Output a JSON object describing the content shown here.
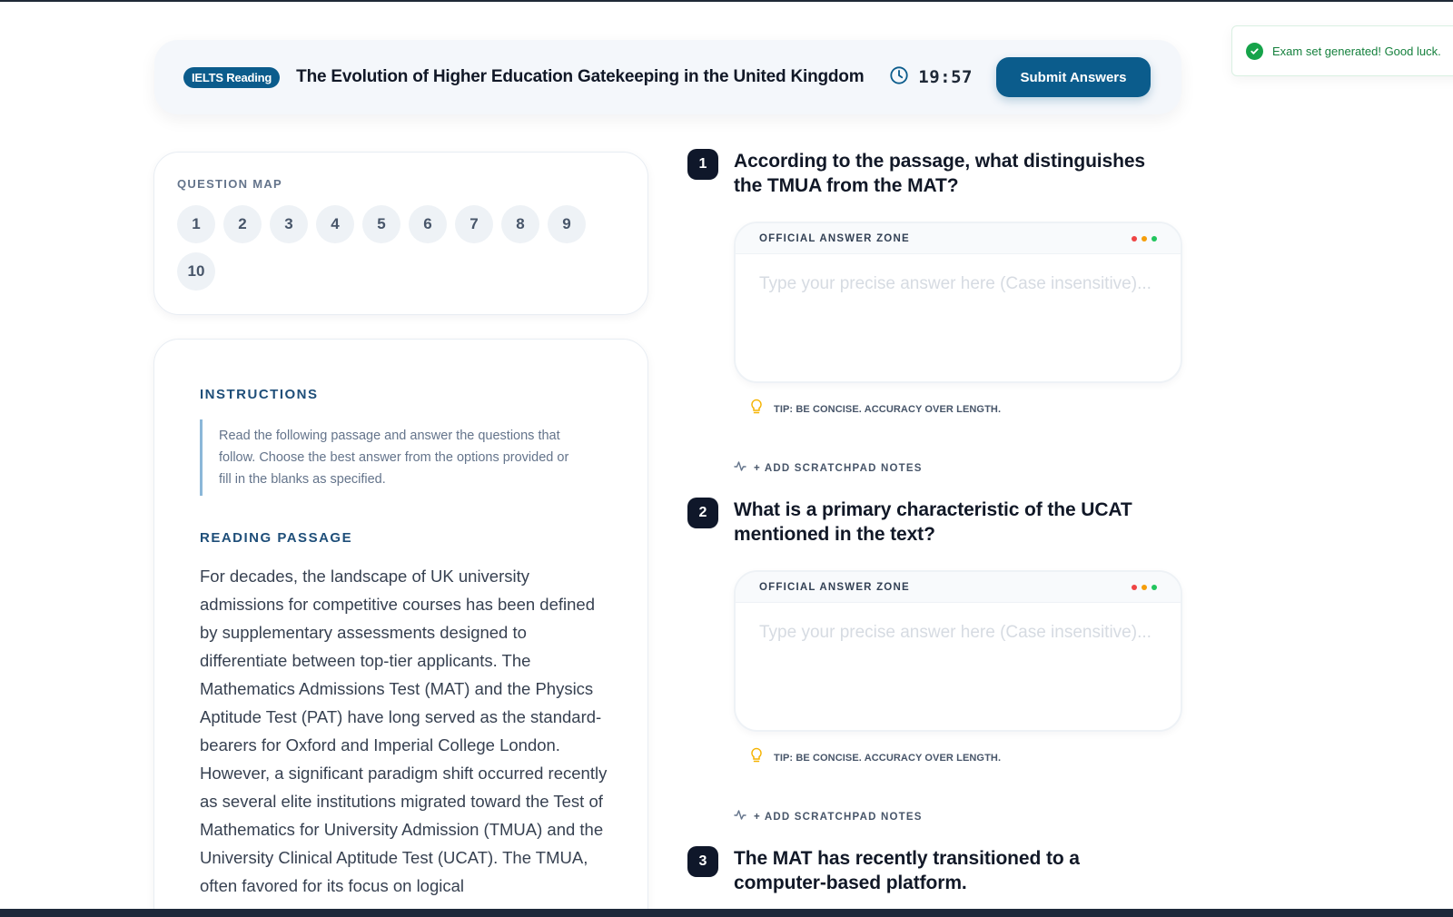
{
  "header": {
    "badge": "IELTS Reading",
    "title": "The Evolution of Higher Education Gatekeeping in the United Kingdom",
    "timer": "19:57",
    "submit_label": "Submit Answers"
  },
  "toast": {
    "message": "Exam set generated! Good luck."
  },
  "question_map": {
    "title": "QUESTION MAP",
    "numbers": [
      "1",
      "2",
      "3",
      "4",
      "5",
      "6",
      "7",
      "8",
      "9",
      "10"
    ]
  },
  "passage": {
    "instructions_title": "INSTRUCTIONS",
    "instructions_text": "Read the following passage and answer the questions that follow. Choose the best answer from the options provided or fill in the blanks as specified.",
    "reading_title": "READING PASSAGE",
    "text": "For decades, the landscape of UK university admissions for competitive courses has been defined by supplementary assessments designed to differentiate between top-tier applicants. The Mathematics Admissions Test (MAT) and the Physics Aptitude Test (PAT) have long served as the standard-bearers for Oxford and Imperial College London. However, a significant paradigm shift occurred recently as several elite institutions migrated toward the Test of Mathematics for University Admission (TMUA) and the University Clinical Aptitude Test (UCAT). The TMUA, often favored for its focus on logical"
  },
  "answer_zone": {
    "label": "OFFICIAL ANSWER ZONE",
    "placeholder": "Type your precise answer here (Case insensitive)...",
    "tip": "TIP: BE CONCISE. ACCURACY OVER LENGTH.",
    "scratchpad": "+ ADD SCRATCHPAD NOTES",
    "dot_colors": [
      "#ef4444",
      "#f59e0b",
      "#22c55e"
    ]
  },
  "questions": [
    {
      "number": "1",
      "text": "According to the passage, what distinguishes the TMUA from the MAT?"
    },
    {
      "number": "2",
      "text": "What is a primary characteristic of the UCAT mentioned in the text?"
    },
    {
      "number": "3",
      "text": "The MAT has recently transitioned to a computer-based platform."
    }
  ],
  "colors": {
    "accent": "#0b5c8c",
    "success": "#16a34a",
    "question_number_bg": "#0f172a"
  }
}
